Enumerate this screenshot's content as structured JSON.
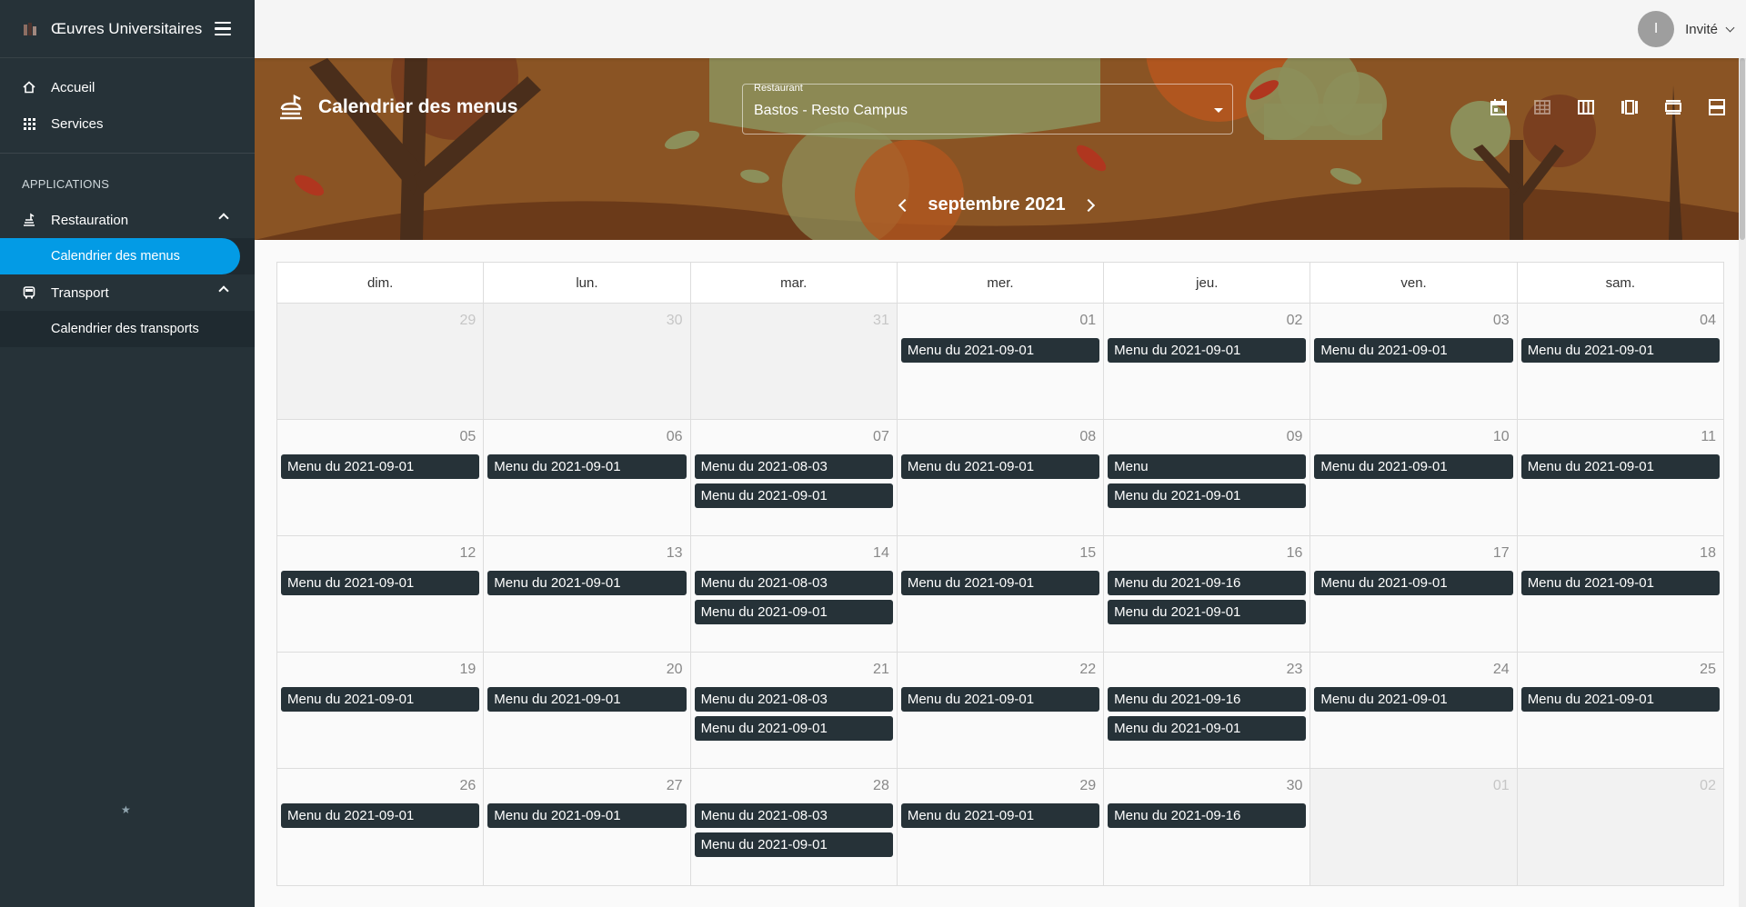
{
  "sidebar": {
    "app_title": "Œuvres Universitaires",
    "nav": [
      {
        "label": "Accueil",
        "icon": "home-icon"
      },
      {
        "label": "Services",
        "icon": "grid-icon"
      }
    ],
    "section_label": "APPLICATIONS",
    "groups": [
      {
        "label": "Restauration",
        "icon": "food-icon",
        "items": [
          "Calendrier des menus"
        ]
      },
      {
        "label": "Transport",
        "icon": "bus-icon",
        "items": [
          "Calendrier des transports"
        ]
      }
    ],
    "footer_glyph": "★"
  },
  "topbar": {
    "user_initial": "I",
    "user_name": "Invité"
  },
  "header": {
    "title": "Calendrier des menus",
    "restaurant_label": "Restaurant",
    "restaurant_value": "Bastos - Resto Campus",
    "month_label": "septembre 2021",
    "view_icons": [
      "calendar-icon",
      "month-grid-icon",
      "week-columns-icon",
      "week-icon",
      "day-icon",
      "list-icon"
    ]
  },
  "calendar": {
    "weekdays": [
      "dim.",
      "lun.",
      "mar.",
      "mer.",
      "jeu.",
      "ven.",
      "sam."
    ],
    "weeks": [
      [
        {
          "day": "29",
          "other": true,
          "events": []
        },
        {
          "day": "30",
          "other": true,
          "events": []
        },
        {
          "day": "31",
          "other": true,
          "events": []
        },
        {
          "day": "01",
          "other": false,
          "events": [
            "Menu du 2021-09-01"
          ]
        },
        {
          "day": "02",
          "other": false,
          "events": [
            "Menu du 2021-09-01"
          ]
        },
        {
          "day": "03",
          "other": false,
          "events": [
            "Menu du 2021-09-01"
          ]
        },
        {
          "day": "04",
          "other": false,
          "events": [
            "Menu du 2021-09-01"
          ]
        }
      ],
      [
        {
          "day": "05",
          "other": false,
          "events": [
            "Menu du 2021-09-01"
          ]
        },
        {
          "day": "06",
          "other": false,
          "events": [
            "Menu du 2021-09-01"
          ]
        },
        {
          "day": "07",
          "other": false,
          "events": [
            "Menu du 2021-08-03",
            "Menu du 2021-09-01"
          ]
        },
        {
          "day": "08",
          "other": false,
          "events": [
            "Menu du 2021-09-01"
          ]
        },
        {
          "day": "09",
          "other": false,
          "events": [
            "Menu",
            "Menu du 2021-09-01"
          ]
        },
        {
          "day": "10",
          "other": false,
          "events": [
            "Menu du 2021-09-01"
          ]
        },
        {
          "day": "11",
          "other": false,
          "events": [
            "Menu du 2021-09-01"
          ]
        }
      ],
      [
        {
          "day": "12",
          "other": false,
          "events": [
            "Menu du 2021-09-01"
          ]
        },
        {
          "day": "13",
          "other": false,
          "events": [
            "Menu du 2021-09-01"
          ]
        },
        {
          "day": "14",
          "other": false,
          "events": [
            "Menu du 2021-08-03",
            "Menu du 2021-09-01"
          ]
        },
        {
          "day": "15",
          "other": false,
          "events": [
            "Menu du 2021-09-01"
          ]
        },
        {
          "day": "16",
          "other": false,
          "events": [
            "Menu du 2021-09-16",
            "Menu du 2021-09-01"
          ]
        },
        {
          "day": "17",
          "other": false,
          "events": [
            "Menu du 2021-09-01"
          ]
        },
        {
          "day": "18",
          "other": false,
          "events": [
            "Menu du 2021-09-01"
          ]
        }
      ],
      [
        {
          "day": "19",
          "other": false,
          "events": [
            "Menu du 2021-09-01"
          ]
        },
        {
          "day": "20",
          "other": false,
          "events": [
            "Menu du 2021-09-01"
          ]
        },
        {
          "day": "21",
          "other": false,
          "events": [
            "Menu du 2021-08-03",
            "Menu du 2021-09-01"
          ]
        },
        {
          "day": "22",
          "other": false,
          "events": [
            "Menu du 2021-09-01"
          ]
        },
        {
          "day": "23",
          "other": false,
          "events": [
            "Menu du 2021-09-16",
            "Menu du 2021-09-01"
          ]
        },
        {
          "day": "24",
          "other": false,
          "events": [
            "Menu du 2021-09-01"
          ]
        },
        {
          "day": "25",
          "other": false,
          "events": [
            "Menu du 2021-09-01"
          ]
        }
      ],
      [
        {
          "day": "26",
          "other": false,
          "events": [
            "Menu du 2021-09-01"
          ]
        },
        {
          "day": "27",
          "other": false,
          "events": [
            "Menu du 2021-09-01"
          ]
        },
        {
          "day": "28",
          "other": false,
          "events": [
            "Menu du 2021-08-03",
            "Menu du 2021-09-01"
          ]
        },
        {
          "day": "29",
          "other": false,
          "events": [
            "Menu du 2021-09-01"
          ]
        },
        {
          "day": "30",
          "other": false,
          "events": [
            "Menu du 2021-09-16"
          ]
        },
        {
          "day": "01",
          "other": true,
          "events": []
        },
        {
          "day": "02",
          "other": true,
          "events": []
        }
      ]
    ]
  },
  "colors": {
    "sidebar_bg": "#263238",
    "active_item": "#039be5",
    "event_bg": "#263238",
    "header_bg": "#8a5424"
  }
}
